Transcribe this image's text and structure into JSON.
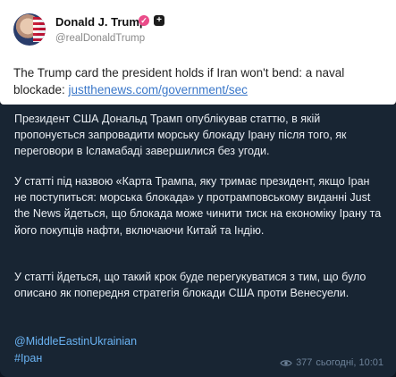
{
  "card": {
    "name": "Donald J. Trump",
    "handle": "@realDonaldTrump",
    "verified_icon": "verified-badge-icon",
    "flag_icon": "flag-badge-icon",
    "text": "The Trump card the president holds if Iran won't bend: a naval blockade: ",
    "link": "justthenews.com/government/sec"
  },
  "message": {
    "p1": "Президент США Дональд Трамп опублікував статтю, в якій пропонується запровадити морську блокаду Ірану після того, як переговори в Ісламабаді завершилися без угоди.",
    "p2": "У статті під назвою «Карта Трампа, яку тримає президент, якщо Іран не поступиться: морська блокада» у протрамповському виданні Just the News йдеться, що блокада може чинити тиск на економіку Ірану та його покупців нафти, включаючи Китай та Індію.",
    "p3": "У статті йдеться, що такий крок буде перегукуватися з тим, що було описано як попередня стратегія блокади США проти Венесуели.",
    "mention": "@MiddleEastinUkrainian",
    "hashtag": "#Іран",
    "views": "377",
    "time": "сьогодні, 10:01"
  },
  "colors": {
    "background": "#0e1621",
    "bubble": "#182533",
    "link": "#6ab3f3",
    "meta": "#6d8299"
  }
}
